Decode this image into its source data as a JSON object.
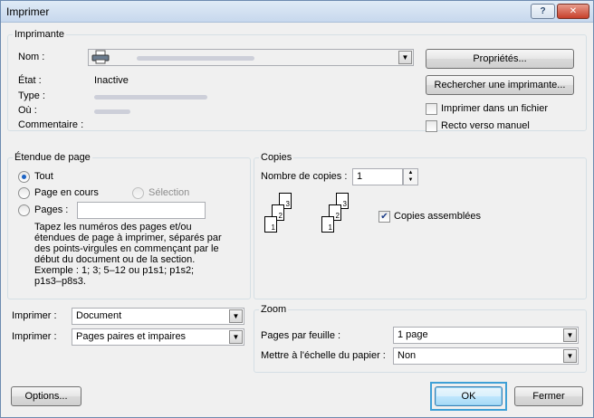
{
  "window": {
    "title": "Imprimer",
    "help_glyph": "?",
    "close_glyph": "✕"
  },
  "printer": {
    "group_label": "Imprimante",
    "name_label": "Nom :",
    "status_label": "État :",
    "status_value": "Inactive",
    "type_label": "Type :",
    "where_label": "Où :",
    "comment_label": "Commentaire :",
    "properties_button": "Propriétés...",
    "find_printer_button": "Rechercher une imprimante...",
    "print_to_file": "Imprimer dans un fichier",
    "manual_duplex": "Recto verso manuel",
    "print_to_file_checked": false,
    "manual_duplex_checked": false
  },
  "page_range": {
    "group_label": "Étendue de page",
    "all": "Tout",
    "current_page": "Page en cours",
    "selection": "Sélection",
    "pages": "Pages :",
    "pages_value": "",
    "selected": "all",
    "help_lines": [
      "Tapez les numéros des pages et/ou",
      "étendues de page à imprimer, séparés par",
      "des points-virgules en commençant par le",
      "début du document ou de la section.",
      "Exemple : 1; 3; 5–12 ou p1s1; p1s2;",
      "p1s3–p8s3."
    ]
  },
  "copies": {
    "group_label": "Copies",
    "count_label": "Nombre de copies :",
    "count_value": "1",
    "collate_label": "Copies assemblées",
    "collate_checked": true,
    "stack1": [
      "3",
      "2",
      "1"
    ],
    "stack2": [
      "3",
      "2",
      "1"
    ]
  },
  "print_what": {
    "label": "Imprimer :",
    "value": "Document"
  },
  "print_which": {
    "label": "Imprimer :",
    "value": "Pages paires et impaires"
  },
  "zoom": {
    "group_label": "Zoom",
    "pages_per_sheet_label": "Pages par feuille :",
    "pages_per_sheet_value": "1 page",
    "scale_label": "Mettre à l'échelle du papier :",
    "scale_value": "Non"
  },
  "footer": {
    "options_button": "Options...",
    "ok_button": "OK",
    "close_button": "Fermer"
  },
  "icons": {
    "printer": "printer-icon",
    "dropdown": "chevron-down-icon",
    "check": "✔"
  }
}
